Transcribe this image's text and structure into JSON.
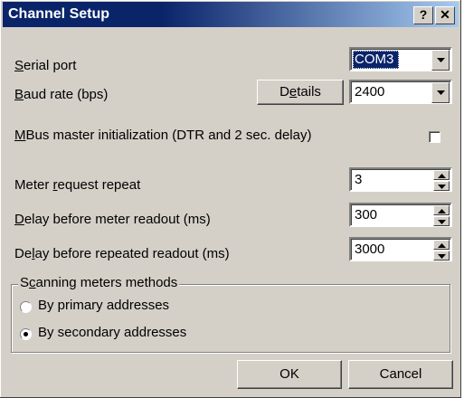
{
  "window": {
    "title": "Channel Setup",
    "help_button": "?",
    "close_button": "✕"
  },
  "serial_port": {
    "label_underlined": "S",
    "label_rest": "erial port",
    "value": "COM3"
  },
  "baud_rate": {
    "label_underlined": "B",
    "label_rest": "aud rate (bps)",
    "details_pre": "D",
    "details_underlined": "e",
    "details_post": "tails",
    "value": "2400"
  },
  "mbus_init": {
    "label_underlined": "M",
    "label_rest": "Bus master initialization (DTR and 2 sec. delay)",
    "checked": false
  },
  "meter_request_repeat": {
    "label_pre": "Meter ",
    "label_underlined": "r",
    "label_rest": "equest repeat",
    "value": "3"
  },
  "delay_before_readout": {
    "label_underlined": "D",
    "label_rest": "elay before meter readout (ms)",
    "value": "300"
  },
  "delay_before_repeated": {
    "label_pre": "De",
    "label_underlined": "l",
    "label_rest": "ay before repeated readout (ms)",
    "value": "3000"
  },
  "scanning": {
    "legend_pre": "S",
    "legend_underlined": "c",
    "legend_rest": "anning meters methods",
    "options": [
      {
        "label": "By primary addresses",
        "selected": false
      },
      {
        "label": "By secondary addresses",
        "selected": true
      }
    ]
  },
  "footer": {
    "ok_label": "OK",
    "cancel_label": "Cancel"
  },
  "colors": {
    "titlebar_start": "#0a246a",
    "titlebar_end": "#a6caf0",
    "dialog_face": "#d4d0c8"
  },
  "icons": [
    "help-icon",
    "close-icon",
    "dropdown-arrow-icon",
    "spin-up-icon",
    "spin-down-icon"
  ]
}
